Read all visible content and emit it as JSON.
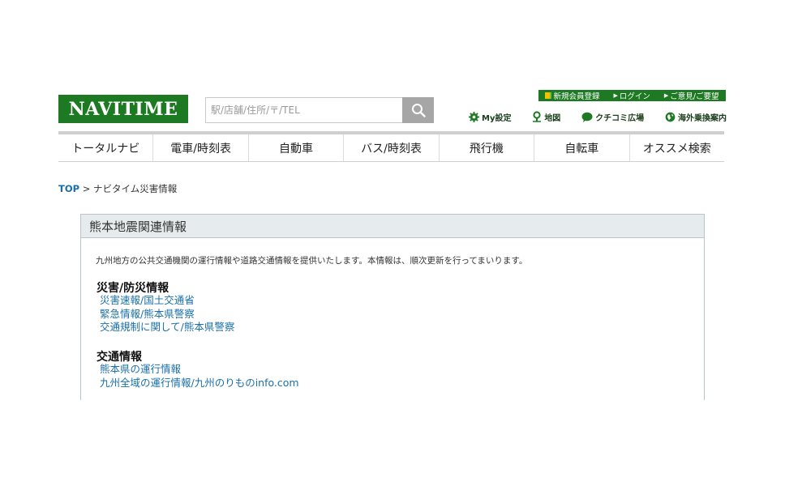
{
  "header": {
    "logo_text": "NAVITIME",
    "search": {
      "placeholder": "駅/店舗/住所/〒/TEL"
    },
    "top_links": [
      {
        "label": "新規会員登録"
      },
      {
        "label": "ログイン"
      },
      {
        "label": "ご意見/ご要望"
      }
    ],
    "utility_links": [
      {
        "label": "My設定",
        "icon": "gear-icon"
      },
      {
        "label": "地図",
        "icon": "map-pin-icon"
      },
      {
        "label": "クチコミ広場",
        "icon": "chat-bubble-icon"
      },
      {
        "label": "海外乗換案内",
        "icon": "globe-icon"
      }
    ]
  },
  "nav": {
    "items": [
      {
        "label": "トータルナビ"
      },
      {
        "label": "電車/時刻表"
      },
      {
        "label": "自動車"
      },
      {
        "label": "バス/時刻表"
      },
      {
        "label": "飛行機"
      },
      {
        "label": "自転車"
      },
      {
        "label": "オススメ検索"
      }
    ]
  },
  "breadcrumb": {
    "top": "TOP",
    "separator": ">",
    "current": "ナビタイム災害情報"
  },
  "panel": {
    "title": "熊本地震関連情報",
    "intro": "九州地方の公共交通機関の運行情報や道路交通情報を提供いたします。本情報は、順次更新を行ってまいります。",
    "sections": [
      {
        "title": "災害/防災情報",
        "links": [
          "災害速報/国土交通省",
          "緊急情報/熊本県警察",
          "交通規制に関して/熊本県警察"
        ]
      },
      {
        "title": "交通情報",
        "links": [
          "熊本県の運行情報",
          "九州全域の運行情報/九州のりものinfo.com"
        ]
      }
    ]
  },
  "colors": {
    "brand_green": "#1e7a22",
    "link_blue": "#1a6fa8",
    "panel_header_bg": "#e6ecee"
  }
}
